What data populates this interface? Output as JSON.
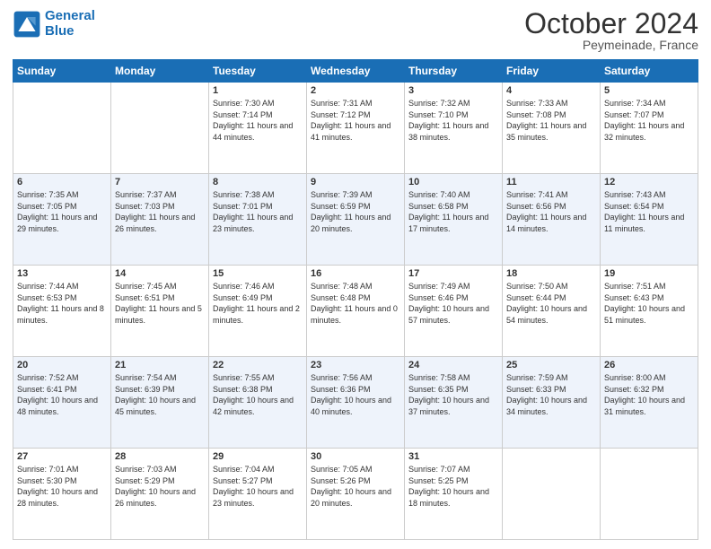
{
  "header": {
    "logo_line1": "General",
    "logo_line2": "Blue",
    "month": "October 2024",
    "location": "Peymeinade, France"
  },
  "days_of_week": [
    "Sunday",
    "Monday",
    "Tuesday",
    "Wednesday",
    "Thursday",
    "Friday",
    "Saturday"
  ],
  "weeks": [
    [
      {
        "day": "",
        "sunrise": "",
        "sunset": "",
        "daylight": ""
      },
      {
        "day": "",
        "sunrise": "",
        "sunset": "",
        "daylight": ""
      },
      {
        "day": "1",
        "sunrise": "Sunrise: 7:30 AM",
        "sunset": "Sunset: 7:14 PM",
        "daylight": "Daylight: 11 hours and 44 minutes."
      },
      {
        "day": "2",
        "sunrise": "Sunrise: 7:31 AM",
        "sunset": "Sunset: 7:12 PM",
        "daylight": "Daylight: 11 hours and 41 minutes."
      },
      {
        "day": "3",
        "sunrise": "Sunrise: 7:32 AM",
        "sunset": "Sunset: 7:10 PM",
        "daylight": "Daylight: 11 hours and 38 minutes."
      },
      {
        "day": "4",
        "sunrise": "Sunrise: 7:33 AM",
        "sunset": "Sunset: 7:08 PM",
        "daylight": "Daylight: 11 hours and 35 minutes."
      },
      {
        "day": "5",
        "sunrise": "Sunrise: 7:34 AM",
        "sunset": "Sunset: 7:07 PM",
        "daylight": "Daylight: 11 hours and 32 minutes."
      }
    ],
    [
      {
        "day": "6",
        "sunrise": "Sunrise: 7:35 AM",
        "sunset": "Sunset: 7:05 PM",
        "daylight": "Daylight: 11 hours and 29 minutes."
      },
      {
        "day": "7",
        "sunrise": "Sunrise: 7:37 AM",
        "sunset": "Sunset: 7:03 PM",
        "daylight": "Daylight: 11 hours and 26 minutes."
      },
      {
        "day": "8",
        "sunrise": "Sunrise: 7:38 AM",
        "sunset": "Sunset: 7:01 PM",
        "daylight": "Daylight: 11 hours and 23 minutes."
      },
      {
        "day": "9",
        "sunrise": "Sunrise: 7:39 AM",
        "sunset": "Sunset: 6:59 PM",
        "daylight": "Daylight: 11 hours and 20 minutes."
      },
      {
        "day": "10",
        "sunrise": "Sunrise: 7:40 AM",
        "sunset": "Sunset: 6:58 PM",
        "daylight": "Daylight: 11 hours and 17 minutes."
      },
      {
        "day": "11",
        "sunrise": "Sunrise: 7:41 AM",
        "sunset": "Sunset: 6:56 PM",
        "daylight": "Daylight: 11 hours and 14 minutes."
      },
      {
        "day": "12",
        "sunrise": "Sunrise: 7:43 AM",
        "sunset": "Sunset: 6:54 PM",
        "daylight": "Daylight: 11 hours and 11 minutes."
      }
    ],
    [
      {
        "day": "13",
        "sunrise": "Sunrise: 7:44 AM",
        "sunset": "Sunset: 6:53 PM",
        "daylight": "Daylight: 11 hours and 8 minutes."
      },
      {
        "day": "14",
        "sunrise": "Sunrise: 7:45 AM",
        "sunset": "Sunset: 6:51 PM",
        "daylight": "Daylight: 11 hours and 5 minutes."
      },
      {
        "day": "15",
        "sunrise": "Sunrise: 7:46 AM",
        "sunset": "Sunset: 6:49 PM",
        "daylight": "Daylight: 11 hours and 2 minutes."
      },
      {
        "day": "16",
        "sunrise": "Sunrise: 7:48 AM",
        "sunset": "Sunset: 6:48 PM",
        "daylight": "Daylight: 11 hours and 0 minutes."
      },
      {
        "day": "17",
        "sunrise": "Sunrise: 7:49 AM",
        "sunset": "Sunset: 6:46 PM",
        "daylight": "Daylight: 10 hours and 57 minutes."
      },
      {
        "day": "18",
        "sunrise": "Sunrise: 7:50 AM",
        "sunset": "Sunset: 6:44 PM",
        "daylight": "Daylight: 10 hours and 54 minutes."
      },
      {
        "day": "19",
        "sunrise": "Sunrise: 7:51 AM",
        "sunset": "Sunset: 6:43 PM",
        "daylight": "Daylight: 10 hours and 51 minutes."
      }
    ],
    [
      {
        "day": "20",
        "sunrise": "Sunrise: 7:52 AM",
        "sunset": "Sunset: 6:41 PM",
        "daylight": "Daylight: 10 hours and 48 minutes."
      },
      {
        "day": "21",
        "sunrise": "Sunrise: 7:54 AM",
        "sunset": "Sunset: 6:39 PM",
        "daylight": "Daylight: 10 hours and 45 minutes."
      },
      {
        "day": "22",
        "sunrise": "Sunrise: 7:55 AM",
        "sunset": "Sunset: 6:38 PM",
        "daylight": "Daylight: 10 hours and 42 minutes."
      },
      {
        "day": "23",
        "sunrise": "Sunrise: 7:56 AM",
        "sunset": "Sunset: 6:36 PM",
        "daylight": "Daylight: 10 hours and 40 minutes."
      },
      {
        "day": "24",
        "sunrise": "Sunrise: 7:58 AM",
        "sunset": "Sunset: 6:35 PM",
        "daylight": "Daylight: 10 hours and 37 minutes."
      },
      {
        "day": "25",
        "sunrise": "Sunrise: 7:59 AM",
        "sunset": "Sunset: 6:33 PM",
        "daylight": "Daylight: 10 hours and 34 minutes."
      },
      {
        "day": "26",
        "sunrise": "Sunrise: 8:00 AM",
        "sunset": "Sunset: 6:32 PM",
        "daylight": "Daylight: 10 hours and 31 minutes."
      }
    ],
    [
      {
        "day": "27",
        "sunrise": "Sunrise: 7:01 AM",
        "sunset": "Sunset: 5:30 PM",
        "daylight": "Daylight: 10 hours and 28 minutes."
      },
      {
        "day": "28",
        "sunrise": "Sunrise: 7:03 AM",
        "sunset": "Sunset: 5:29 PM",
        "daylight": "Daylight: 10 hours and 26 minutes."
      },
      {
        "day": "29",
        "sunrise": "Sunrise: 7:04 AM",
        "sunset": "Sunset: 5:27 PM",
        "daylight": "Daylight: 10 hours and 23 minutes."
      },
      {
        "day": "30",
        "sunrise": "Sunrise: 7:05 AM",
        "sunset": "Sunset: 5:26 PM",
        "daylight": "Daylight: 10 hours and 20 minutes."
      },
      {
        "day": "31",
        "sunrise": "Sunrise: 7:07 AM",
        "sunset": "Sunset: 5:25 PM",
        "daylight": "Daylight: 10 hours and 18 minutes."
      },
      {
        "day": "",
        "sunrise": "",
        "sunset": "",
        "daylight": ""
      },
      {
        "day": "",
        "sunrise": "",
        "sunset": "",
        "daylight": ""
      }
    ]
  ]
}
